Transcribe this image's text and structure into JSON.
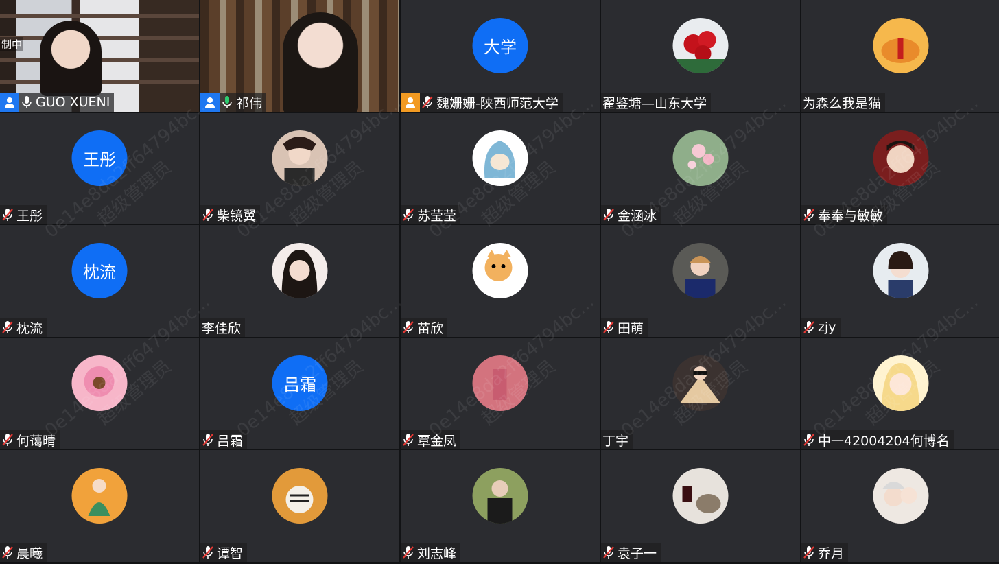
{
  "recording_label": "制中",
  "watermark_id": "0e14e8da2ff64794bc...",
  "watermark_role": "超级管理员",
  "colors": {
    "accent_blue": "#0f6ef5",
    "role_blue": "#1f78f1",
    "role_orange": "#f29a22",
    "mic_on": "#2ecc71"
  },
  "participants": [
    {
      "name": "GUO XUENI",
      "type": "video",
      "mic": "on",
      "role": "blue"
    },
    {
      "name": "祁伟",
      "type": "video",
      "mic": "on",
      "role": "blue"
    },
    {
      "name": "魏姗姗-陕西师范大学",
      "type": "text",
      "avatar_text": "大学",
      "mic": "muted",
      "role": "orange"
    },
    {
      "name": "翟鉴塘—山东大学",
      "type": "image",
      "avatar_icon": "flower-avatar-icon",
      "mic": "none"
    },
    {
      "name": "为森么我是猫",
      "type": "image",
      "avatar_icon": "cat-avatar-icon",
      "mic": "none"
    },
    {
      "name": "王彤",
      "type": "text",
      "avatar_text": "王彤",
      "mic": "muted"
    },
    {
      "name": "柴镜翼",
      "type": "image",
      "avatar_icon": "person-avatar-icon",
      "mic": "muted"
    },
    {
      "name": "苏莹莹",
      "type": "image",
      "avatar_icon": "shark-cat-avatar-icon",
      "mic": "muted"
    },
    {
      "name": "金涵冰",
      "type": "image",
      "avatar_icon": "blossom-avatar-icon",
      "mic": "muted"
    },
    {
      "name": "奉奉与敏敏",
      "type": "image",
      "avatar_icon": "child-avatar-icon",
      "mic": "muted"
    },
    {
      "name": "枕流",
      "type": "text",
      "avatar_text": "枕流",
      "mic": "muted"
    },
    {
      "name": "李佳欣",
      "type": "image",
      "avatar_icon": "girl-avatar-icon",
      "mic": "none"
    },
    {
      "name": "苗欣",
      "type": "image",
      "avatar_icon": "cartoon-cat-avatar-icon",
      "mic": "muted"
    },
    {
      "name": "田萌",
      "type": "image",
      "avatar_icon": "kid-avatar-icon",
      "mic": "muted"
    },
    {
      "name": "zjy",
      "type": "image",
      "avatar_icon": "little-girl-avatar-icon",
      "mic": "muted"
    },
    {
      "name": "何蔼晴",
      "type": "image",
      "avatar_icon": "pink-bear-avatar-icon",
      "mic": "muted"
    },
    {
      "name": "吕霜",
      "type": "text",
      "avatar_text": "吕霜",
      "mic": "muted"
    },
    {
      "name": "覃金凤",
      "type": "image",
      "avatar_icon": "pink-avatar-icon",
      "mic": "muted"
    },
    {
      "name": "丁宇",
      "type": "image",
      "avatar_icon": "fan-avatar-icon",
      "mic": "none"
    },
    {
      "name": "中一42004204何博名",
      "type": "image",
      "avatar_icon": "anime-girl-avatar-icon",
      "mic": "muted"
    },
    {
      "name": "晨曦",
      "type": "image",
      "avatar_icon": "lady-illustration-avatar-icon",
      "mic": "muted"
    },
    {
      "name": "谭智",
      "type": "image",
      "avatar_icon": "tiger-avatar-icon",
      "mic": "muted"
    },
    {
      "name": "刘志峰",
      "type": "image",
      "avatar_icon": "man-avatar-icon",
      "mic": "muted"
    },
    {
      "name": "袁子一",
      "type": "image",
      "avatar_icon": "wine-cat-avatar-icon",
      "mic": "muted"
    },
    {
      "name": "乔月",
      "type": "image",
      "avatar_icon": "mother-child-avatar-icon",
      "mic": "muted"
    }
  ]
}
